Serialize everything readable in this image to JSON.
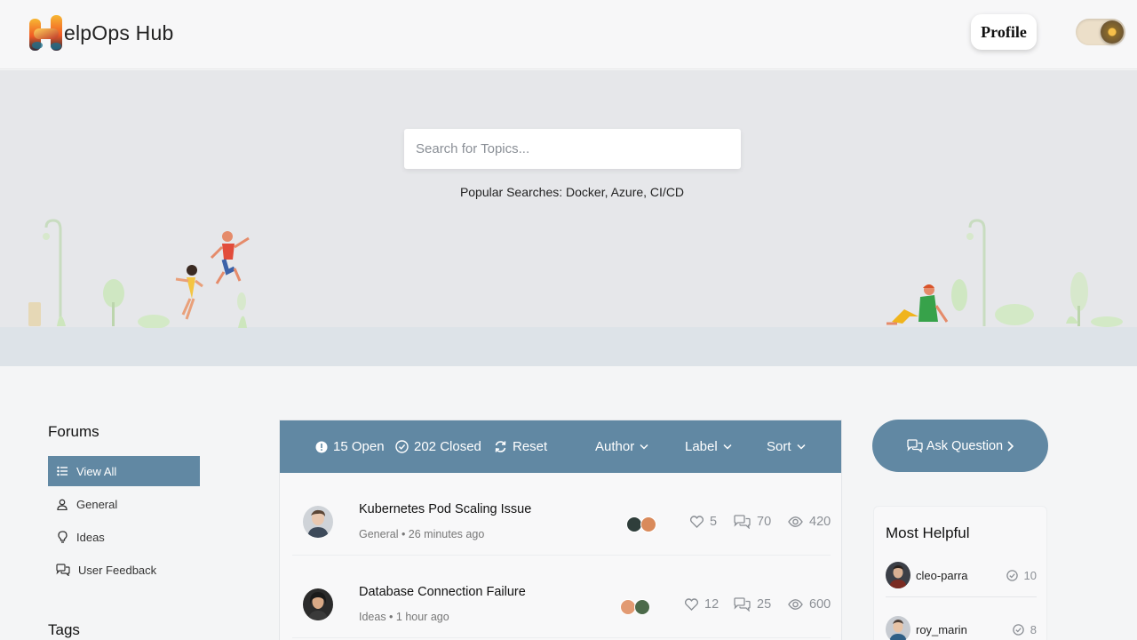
{
  "header": {
    "brand": "elpOps Hub",
    "profile_label": "Profile"
  },
  "hero": {
    "search_placeholder": "Search for Topics...",
    "popular_searches": "Popular Searches: Docker, Azure, CI/CD"
  },
  "sidebar": {
    "title": "Forums",
    "items": [
      {
        "label": "View All",
        "icon": "list-icon",
        "active": true
      },
      {
        "label": "General",
        "icon": "user-icon",
        "active": false
      },
      {
        "label": "Ideas",
        "icon": "lightbulb-icon",
        "active": false
      },
      {
        "label": "User Feedback",
        "icon": "chat-bubbles-icon",
        "active": false
      }
    ],
    "tags_title": "Tags"
  },
  "toolbar": {
    "open_label": "15 Open",
    "closed_label": "202 Closed",
    "reset_label": "Reset",
    "author_label": "Author",
    "label_label": "Label",
    "sort_label": "Sort"
  },
  "topics": [
    {
      "title": "Kubernetes Pod Scaling Issue",
      "category": "General",
      "time": "26 minutes ago",
      "meta": "General • 26 minutes ago",
      "likes": "5",
      "replies": "70",
      "views": "420"
    },
    {
      "title": "Database Connection Failure",
      "category": "Ideas",
      "time": "1 hour ago",
      "meta": "Ideas • 1 hour ago",
      "likes": "12",
      "replies": "25",
      "views": "600"
    }
  ],
  "ask_question_label": "Ask Question",
  "most_helpful": {
    "title": "Most Helpful",
    "users": [
      {
        "name": "cleo-parra",
        "score": "10"
      },
      {
        "name": "roy_marin",
        "score": "8"
      }
    ]
  },
  "colors": {
    "accent": "#6188a3",
    "hero_bg": "#e6e7ea",
    "page_bg": "#f4f5f6"
  }
}
